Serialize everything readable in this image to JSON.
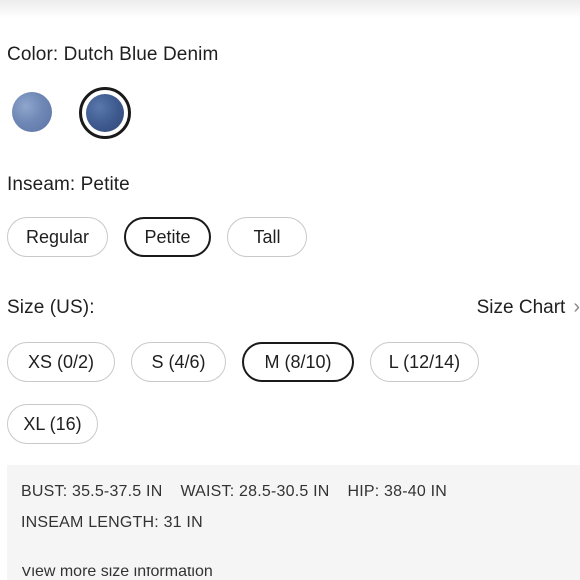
{
  "color": {
    "label": "Color: Dutch Blue Denim",
    "swatches": [
      {
        "name": "light-denim",
        "hex": "#6f88b6"
      },
      {
        "name": "dutch-blue-denim",
        "hex": "#3f5b90",
        "selected": true
      }
    ]
  },
  "inseam": {
    "label": "Inseam: Petite",
    "options": [
      {
        "label": "Regular",
        "selected": false
      },
      {
        "label": "Petite",
        "selected": true
      },
      {
        "label": "Tall",
        "selected": false
      }
    ]
  },
  "size": {
    "label": "Size (US):",
    "chart_link": "Size Chart",
    "chart_icon": "chevron-right-icon",
    "options": [
      {
        "label": "XS (0/2)",
        "selected": false
      },
      {
        "label": "S (4/6)",
        "selected": false
      },
      {
        "label": "M (8/10)",
        "selected": true
      },
      {
        "label": "L (12/14)",
        "selected": false
      },
      {
        "label": "XL (16)",
        "selected": false
      }
    ]
  },
  "measurements": {
    "bust": "BUST: 35.5-37.5 IN",
    "waist": "WAIST: 28.5-30.5 IN",
    "hip": "HIP: 38-40 IN",
    "inseam_length": "INSEAM LENGTH: 31 IN",
    "more_link": "View more size information"
  },
  "colors": {
    "selected_border": "#1a1a1a",
    "unselected_border": "#c9c9c9",
    "panel_bg": "#f5f5f5"
  }
}
